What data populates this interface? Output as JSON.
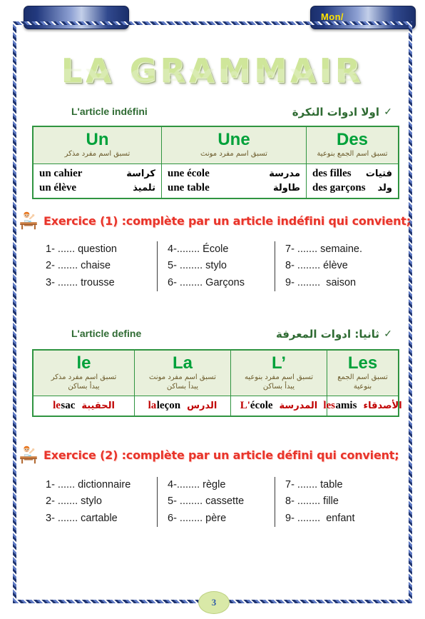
{
  "header": {
    "banner_left_label": "",
    "banner_right_label": "Mon/"
  },
  "title": {
    "text": "LA GRAMMAIR"
  },
  "sections": [
    {
      "french_heading": "L'article indéfini",
      "arabic_heading": "اولا ادوات النكرة",
      "check_mark": "✓",
      "columns": [
        {
          "article": "Un",
          "arabic_rule": "تسبق اسم مفرد مذكر",
          "examples": [
            {
              "french": "un cahier",
              "arabic": "كراسة"
            },
            {
              "french": "un élève",
              "arabic": "تلميذ"
            }
          ]
        },
        {
          "article": "Une",
          "arabic_rule": "تسبق اسم مفرد مونث",
          "examples": [
            {
              "french": "une école",
              "arabic": "مدرسة"
            },
            {
              "french": "une table",
              "arabic": "طاولة"
            }
          ]
        },
        {
          "article": "Des",
          "arabic_rule": "تسبق اسم الجمع بنوعية",
          "examples": [
            {
              "french": "des filles",
              "arabic": "فتيات"
            },
            {
              "french": "des garçons",
              "arabic": "ولد"
            }
          ]
        }
      ]
    },
    {
      "french_heading": "L'article define",
      "arabic_heading": "ثانيا: ادوات المعرفة",
      "check_mark": "✓",
      "columns": [
        {
          "article": "le",
          "arabic_rule": "تسبق اسم مفرد مذكر\nيبدأ بساكن",
          "example": {
            "article": "le",
            "noun": "sac",
            "arabic": "الحقيبة"
          }
        },
        {
          "article": "La",
          "arabic_rule": "تسبق اسم مفرد مونث\nيبدأ بساكن",
          "example": {
            "article": "la",
            "noun": "leçon",
            "arabic": "الدرس"
          }
        },
        {
          "article": "L’",
          "arabic_rule": "تسبق اسم مفرد بنوعيه\nيبدأ بساكن",
          "example": {
            "article": "L'",
            "noun": "école",
            "arabic": "المدرسة"
          }
        },
        {
          "article": "Les",
          "arabic_rule": "تسبق اسم الجمع بنوعية",
          "example": {
            "article": "les",
            "noun": "amis",
            "arabic": "الأصدقاء"
          }
        }
      ]
    }
  ],
  "exercises": [
    {
      "icon": "student-at-desk-icon",
      "title": "Exercice (1) :complète par un article indéfini qui convient;",
      "columns": [
        [
          "1- ...... question",
          "2- ....... chaise",
          "3- ....... trousse"
        ],
        [
          "4-........ École",
          "5- ........ stylo",
          "6- ........ Garçons"
        ],
        [
          "7- ....... semaine.",
          "8- ........ élève",
          "9- ........  saison"
        ]
      ]
    },
    {
      "icon": "student-at-desk-icon",
      "title": "Exercice (2) :complète par un article défini qui convient;",
      "columns": [
        [
          "1- ...... dictionnaire",
          "2- ....... stylo",
          "3- ....... cartable"
        ],
        [
          "4-........ règle",
          "5- ........ cassette",
          "6- ........ père"
        ],
        [
          "7- ....... table",
          "8- ........ fille",
          "9- ........  enfant"
        ]
      ]
    }
  ],
  "footer": {
    "page_number": "3"
  },
  "colors": {
    "title_green": "#cfe69a",
    "heading_green": "#2f6b33",
    "article_green": "#00a13a",
    "exercise_red": "#e8342a",
    "example_red": "#c00000",
    "banner_blue": "#1b2f6b",
    "banner_text_yellow": "#ffe400",
    "table_border_green": "#2f9440",
    "table_header_bg": "#e9f0dc",
    "page_badge_bg": "#d9e9a8",
    "page_number_blue": "#2e5aa8"
  }
}
